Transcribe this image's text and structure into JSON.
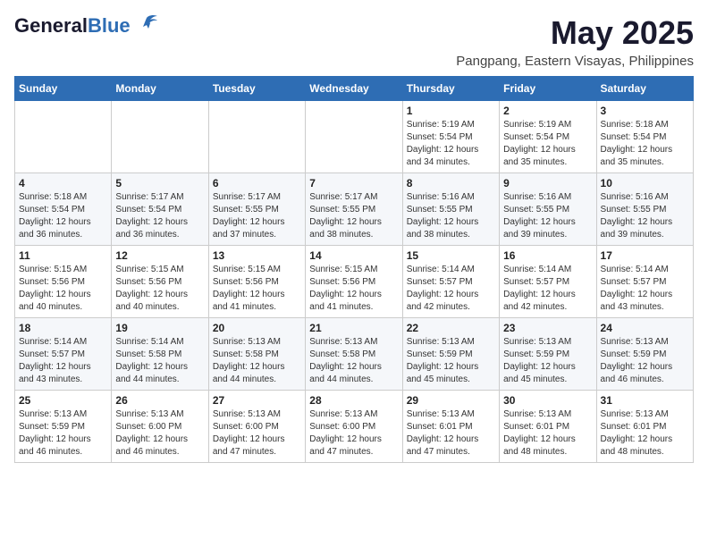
{
  "header": {
    "logo_general": "General",
    "logo_blue": "Blue",
    "month": "May 2025",
    "location": "Pangpang, Eastern Visayas, Philippines"
  },
  "weekdays": [
    "Sunday",
    "Monday",
    "Tuesday",
    "Wednesday",
    "Thursday",
    "Friday",
    "Saturday"
  ],
  "weeks": [
    [
      {
        "day": "",
        "info": ""
      },
      {
        "day": "",
        "info": ""
      },
      {
        "day": "",
        "info": ""
      },
      {
        "day": "",
        "info": ""
      },
      {
        "day": "1",
        "info": "Sunrise: 5:19 AM\nSunset: 5:54 PM\nDaylight: 12 hours\nand 34 minutes."
      },
      {
        "day": "2",
        "info": "Sunrise: 5:19 AM\nSunset: 5:54 PM\nDaylight: 12 hours\nand 35 minutes."
      },
      {
        "day": "3",
        "info": "Sunrise: 5:18 AM\nSunset: 5:54 PM\nDaylight: 12 hours\nand 35 minutes."
      }
    ],
    [
      {
        "day": "4",
        "info": "Sunrise: 5:18 AM\nSunset: 5:54 PM\nDaylight: 12 hours\nand 36 minutes."
      },
      {
        "day": "5",
        "info": "Sunrise: 5:17 AM\nSunset: 5:54 PM\nDaylight: 12 hours\nand 36 minutes."
      },
      {
        "day": "6",
        "info": "Sunrise: 5:17 AM\nSunset: 5:55 PM\nDaylight: 12 hours\nand 37 minutes."
      },
      {
        "day": "7",
        "info": "Sunrise: 5:17 AM\nSunset: 5:55 PM\nDaylight: 12 hours\nand 38 minutes."
      },
      {
        "day": "8",
        "info": "Sunrise: 5:16 AM\nSunset: 5:55 PM\nDaylight: 12 hours\nand 38 minutes."
      },
      {
        "day": "9",
        "info": "Sunrise: 5:16 AM\nSunset: 5:55 PM\nDaylight: 12 hours\nand 39 minutes."
      },
      {
        "day": "10",
        "info": "Sunrise: 5:16 AM\nSunset: 5:55 PM\nDaylight: 12 hours\nand 39 minutes."
      }
    ],
    [
      {
        "day": "11",
        "info": "Sunrise: 5:15 AM\nSunset: 5:56 PM\nDaylight: 12 hours\nand 40 minutes."
      },
      {
        "day": "12",
        "info": "Sunrise: 5:15 AM\nSunset: 5:56 PM\nDaylight: 12 hours\nand 40 minutes."
      },
      {
        "day": "13",
        "info": "Sunrise: 5:15 AM\nSunset: 5:56 PM\nDaylight: 12 hours\nand 41 minutes."
      },
      {
        "day": "14",
        "info": "Sunrise: 5:15 AM\nSunset: 5:56 PM\nDaylight: 12 hours\nand 41 minutes."
      },
      {
        "day": "15",
        "info": "Sunrise: 5:14 AM\nSunset: 5:57 PM\nDaylight: 12 hours\nand 42 minutes."
      },
      {
        "day": "16",
        "info": "Sunrise: 5:14 AM\nSunset: 5:57 PM\nDaylight: 12 hours\nand 42 minutes."
      },
      {
        "day": "17",
        "info": "Sunrise: 5:14 AM\nSunset: 5:57 PM\nDaylight: 12 hours\nand 43 minutes."
      }
    ],
    [
      {
        "day": "18",
        "info": "Sunrise: 5:14 AM\nSunset: 5:57 PM\nDaylight: 12 hours\nand 43 minutes."
      },
      {
        "day": "19",
        "info": "Sunrise: 5:14 AM\nSunset: 5:58 PM\nDaylight: 12 hours\nand 44 minutes."
      },
      {
        "day": "20",
        "info": "Sunrise: 5:13 AM\nSunset: 5:58 PM\nDaylight: 12 hours\nand 44 minutes."
      },
      {
        "day": "21",
        "info": "Sunrise: 5:13 AM\nSunset: 5:58 PM\nDaylight: 12 hours\nand 44 minutes."
      },
      {
        "day": "22",
        "info": "Sunrise: 5:13 AM\nSunset: 5:59 PM\nDaylight: 12 hours\nand 45 minutes."
      },
      {
        "day": "23",
        "info": "Sunrise: 5:13 AM\nSunset: 5:59 PM\nDaylight: 12 hours\nand 45 minutes."
      },
      {
        "day": "24",
        "info": "Sunrise: 5:13 AM\nSunset: 5:59 PM\nDaylight: 12 hours\nand 46 minutes."
      }
    ],
    [
      {
        "day": "25",
        "info": "Sunrise: 5:13 AM\nSunset: 5:59 PM\nDaylight: 12 hours\nand 46 minutes."
      },
      {
        "day": "26",
        "info": "Sunrise: 5:13 AM\nSunset: 6:00 PM\nDaylight: 12 hours\nand 46 minutes."
      },
      {
        "day": "27",
        "info": "Sunrise: 5:13 AM\nSunset: 6:00 PM\nDaylight: 12 hours\nand 47 minutes."
      },
      {
        "day": "28",
        "info": "Sunrise: 5:13 AM\nSunset: 6:00 PM\nDaylight: 12 hours\nand 47 minutes."
      },
      {
        "day": "29",
        "info": "Sunrise: 5:13 AM\nSunset: 6:01 PM\nDaylight: 12 hours\nand 47 minutes."
      },
      {
        "day": "30",
        "info": "Sunrise: 5:13 AM\nSunset: 6:01 PM\nDaylight: 12 hours\nand 48 minutes."
      },
      {
        "day": "31",
        "info": "Sunrise: 5:13 AM\nSunset: 6:01 PM\nDaylight: 12 hours\nand 48 minutes."
      }
    ]
  ]
}
